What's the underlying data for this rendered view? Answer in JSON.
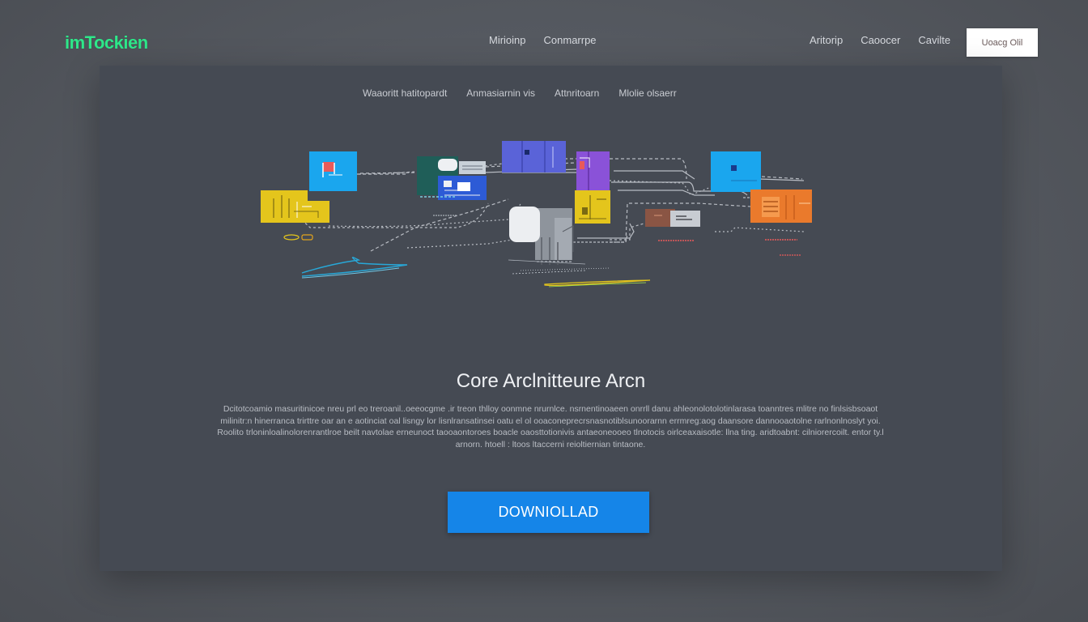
{
  "brand": {
    "logo_text": "imTockien"
  },
  "nav": {
    "center_links": [
      "Mirioinp",
      "Conmarrpe"
    ],
    "right_links": [
      "Aritorip",
      "Caoocer",
      "Cavilte"
    ],
    "cta_label": "Uoacg Olil"
  },
  "tabs": [
    "Waaoritt hatitopardt",
    "Anmasiarnin   vis",
    "Attnritoarn",
    "Mlolie olsaerr"
  ],
  "diagram": {
    "node_colors": {
      "cyan": "#1aa6ee",
      "yellow": "#e4c51c",
      "teal": "#1f5e58",
      "blue": "#2d5bd6",
      "indigo": "#5a63d8",
      "violet": "#8a52d8",
      "orange": "#ea7a2c",
      "brown": "#8a5544",
      "gray": "#8e949c"
    }
  },
  "main": {
    "title": "Core Arclnitteure Arcn",
    "description": "Dcitotcoamio masuritinicoe nreu prl eo treroanil..oeeocgme .ir treon thlloy oonmne nrurnlce. nsrnentinoaeen onrrll danu ahleonolotolotinlarasa toanntres mlitre no finlsisbsoaot milinitr:n hinerranca trirttre oar an e aotinciat oal lisngy lor lisnlransatinsei oatu el ol ooaconeprecrsnasnotiblsunoorarnn errmreg:aog daansore dannooaotolne rarlnonlnoslyt yoi. Roolito trloninloalinolorenrantlroe beilt navtolae erneunoct taooaontoroes boacle oaosttotionivis antaeoneooeo tlnotocis oirlceaxaisotle: llna ting. aridtoabnt: cilniorercoilt. entor ty.l arnorn. htoell : ltoos ltaccerni reioltiernian tintaone.",
    "download_label": "DOWNIOLLAD"
  }
}
